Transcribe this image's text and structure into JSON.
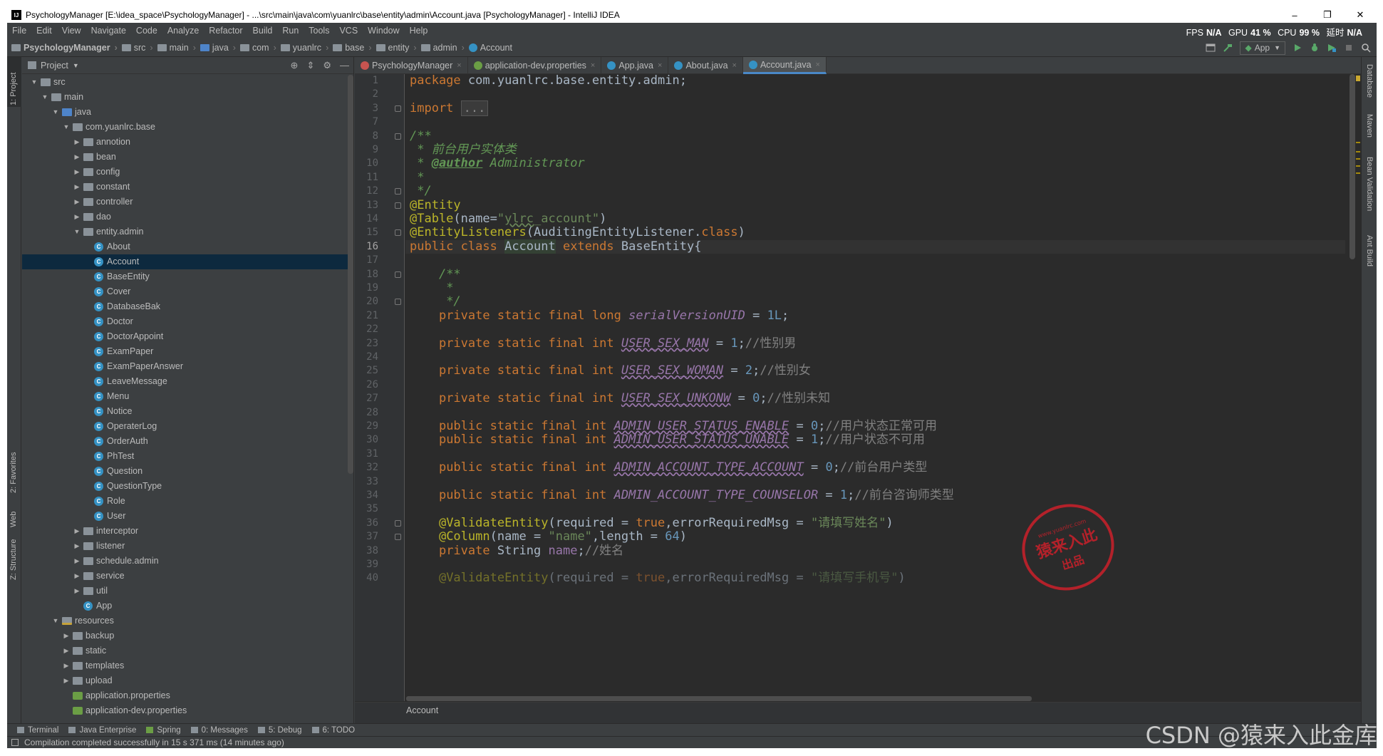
{
  "window": {
    "title": "PsychologyManager [E:\\idea_space\\PsychologyManager] - ...\\src\\main\\java\\com\\yuanlrc\\base\\entity\\admin\\Account.java [PsychologyManager] - IntelliJ IDEA",
    "minimize": "–",
    "maximize": "❐",
    "close": "✕"
  },
  "menu": {
    "items": [
      "File",
      "Edit",
      "View",
      "Navigate",
      "Code",
      "Analyze",
      "Refactor",
      "Build",
      "Run",
      "Tools",
      "VCS",
      "Window",
      "Help"
    ],
    "stats": {
      "fps_label": "FPS",
      "fps": "N/A",
      "gpu_label": "GPU",
      "gpu": "41 %",
      "cpu_label": "CPU",
      "cpu": "99 %",
      "delay_label": "延时",
      "delay": "N/A"
    }
  },
  "nav": {
    "crumbs": [
      "PsychologyManager",
      "src",
      "main",
      "java",
      "com",
      "yuanlrc",
      "base",
      "entity",
      "admin",
      "Account"
    ],
    "run_config": "App"
  },
  "left_strip": {
    "project": "1: Project",
    "favorites": "2: Favorites",
    "web": "Web",
    "structure": "Z: Structure"
  },
  "right_strip": {
    "database": "Database",
    "maven": "Maven",
    "bean": "Bean Validation",
    "ant": "Ant Build"
  },
  "project_panel": {
    "title": "Project"
  },
  "tree": [
    {
      "label": "src",
      "depth": 0,
      "type": "folder",
      "arrow": "▼"
    },
    {
      "label": "main",
      "depth": 1,
      "type": "folder",
      "arrow": "▼"
    },
    {
      "label": "java",
      "depth": 2,
      "type": "src",
      "arrow": "▼"
    },
    {
      "label": "com.yuanlrc.base",
      "depth": 3,
      "type": "folder",
      "arrow": "▼"
    },
    {
      "label": "annotion",
      "depth": 4,
      "type": "folder",
      "arrow": "▶"
    },
    {
      "label": "bean",
      "depth": 4,
      "type": "folder",
      "arrow": "▶"
    },
    {
      "label": "config",
      "depth": 4,
      "type": "folder",
      "arrow": "▶"
    },
    {
      "label": "constant",
      "depth": 4,
      "type": "folder",
      "arrow": "▶"
    },
    {
      "label": "controller",
      "depth": 4,
      "type": "folder",
      "arrow": "▶"
    },
    {
      "label": "dao",
      "depth": 4,
      "type": "folder",
      "arrow": "▶"
    },
    {
      "label": "entity.admin",
      "depth": 4,
      "type": "folder",
      "arrow": "▼"
    },
    {
      "label": "About",
      "depth": 5,
      "type": "class",
      "arrow": ""
    },
    {
      "label": "Account",
      "depth": 5,
      "type": "class",
      "arrow": "",
      "selected": true
    },
    {
      "label": "BaseEntity",
      "depth": 5,
      "type": "class",
      "arrow": ""
    },
    {
      "label": "Cover",
      "depth": 5,
      "type": "class",
      "arrow": ""
    },
    {
      "label": "DatabaseBak",
      "depth": 5,
      "type": "class",
      "arrow": ""
    },
    {
      "label": "Doctor",
      "depth": 5,
      "type": "class",
      "arrow": ""
    },
    {
      "label": "DoctorAppoint",
      "depth": 5,
      "type": "class",
      "arrow": ""
    },
    {
      "label": "ExamPaper",
      "depth": 5,
      "type": "class",
      "arrow": ""
    },
    {
      "label": "ExamPaperAnswer",
      "depth": 5,
      "type": "class",
      "arrow": ""
    },
    {
      "label": "LeaveMessage",
      "depth": 5,
      "type": "class",
      "arrow": ""
    },
    {
      "label": "Menu",
      "depth": 5,
      "type": "class",
      "arrow": ""
    },
    {
      "label": "Notice",
      "depth": 5,
      "type": "class",
      "arrow": ""
    },
    {
      "label": "OperaterLog",
      "depth": 5,
      "type": "class",
      "arrow": ""
    },
    {
      "label": "OrderAuth",
      "depth": 5,
      "type": "class",
      "arrow": ""
    },
    {
      "label": "PhTest",
      "depth": 5,
      "type": "class",
      "arrow": ""
    },
    {
      "label": "Question",
      "depth": 5,
      "type": "class",
      "arrow": ""
    },
    {
      "label": "QuestionType",
      "depth": 5,
      "type": "class",
      "arrow": ""
    },
    {
      "label": "Role",
      "depth": 5,
      "type": "class",
      "arrow": ""
    },
    {
      "label": "User",
      "depth": 5,
      "type": "class",
      "arrow": ""
    },
    {
      "label": "interceptor",
      "depth": 4,
      "type": "folder",
      "arrow": "▶"
    },
    {
      "label": "listener",
      "depth": 4,
      "type": "folder",
      "arrow": "▶"
    },
    {
      "label": "schedule.admin",
      "depth": 4,
      "type": "folder",
      "arrow": "▶"
    },
    {
      "label": "service",
      "depth": 4,
      "type": "folder",
      "arrow": "▶"
    },
    {
      "label": "util",
      "depth": 4,
      "type": "folder",
      "arrow": "▶"
    },
    {
      "label": "App",
      "depth": 4,
      "type": "class",
      "arrow": ""
    },
    {
      "label": "resources",
      "depth": 2,
      "type": "res",
      "arrow": "▼"
    },
    {
      "label": "backup",
      "depth": 3,
      "type": "folder",
      "arrow": "▶"
    },
    {
      "label": "static",
      "depth": 3,
      "type": "folder",
      "arrow": "▶"
    },
    {
      "label": "templates",
      "depth": 3,
      "type": "folder",
      "arrow": "▶"
    },
    {
      "label": "upload",
      "depth": 3,
      "type": "folder",
      "arrow": "▶"
    },
    {
      "label": "application.properties",
      "depth": 3,
      "type": "prop",
      "arrow": ""
    },
    {
      "label": "application-dev.properties",
      "depth": 3,
      "type": "prop",
      "arrow": ""
    }
  ],
  "tabs": [
    {
      "label": "PsychologyManager",
      "icon": "maven-icon",
      "active": false
    },
    {
      "label": "application-dev.properties",
      "icon": "properties-icon",
      "active": false
    },
    {
      "label": "App.java",
      "icon": "class-icon",
      "active": false
    },
    {
      "label": "About.java",
      "icon": "class-icon",
      "active": false
    },
    {
      "label": "Account.java",
      "icon": "class-icon",
      "active": true
    }
  ],
  "line_numbers": [
    "1",
    "2",
    "3",
    "7",
    "8",
    "9",
    "10",
    "11",
    "12",
    "13",
    "14",
    "15",
    "16",
    "17",
    "18",
    "19",
    "20",
    "21",
    "22",
    "23",
    "24",
    "25",
    "26",
    "27",
    "28",
    "29",
    "30",
    "31",
    "32",
    "33",
    "34",
    "35",
    "36",
    "37",
    "38",
    "39",
    "40"
  ],
  "current_line": "16",
  "code_breadcrumb": "Account",
  "bottom_tools": [
    "Terminal",
    "Java Enterprise",
    "Spring",
    "0: Messages",
    "5: Debug",
    "6: TODO"
  ],
  "status": "Compilation completed successfully in 15 s 371 ms (14 minutes ago)",
  "watermark": "CSDN @猿来入此金库",
  "stamp": {
    "line1": "猿来入此",
    "line2": "出品",
    "url": "www.yuanlrc.com"
  },
  "colors": {
    "keyword": "#cc7832",
    "annotation": "#bbb529",
    "string": "#6a8759",
    "number": "#6897bb",
    "comment": "#808080",
    "doc": "#629755",
    "field": "#9876aa",
    "accent": "#4a88c7"
  }
}
